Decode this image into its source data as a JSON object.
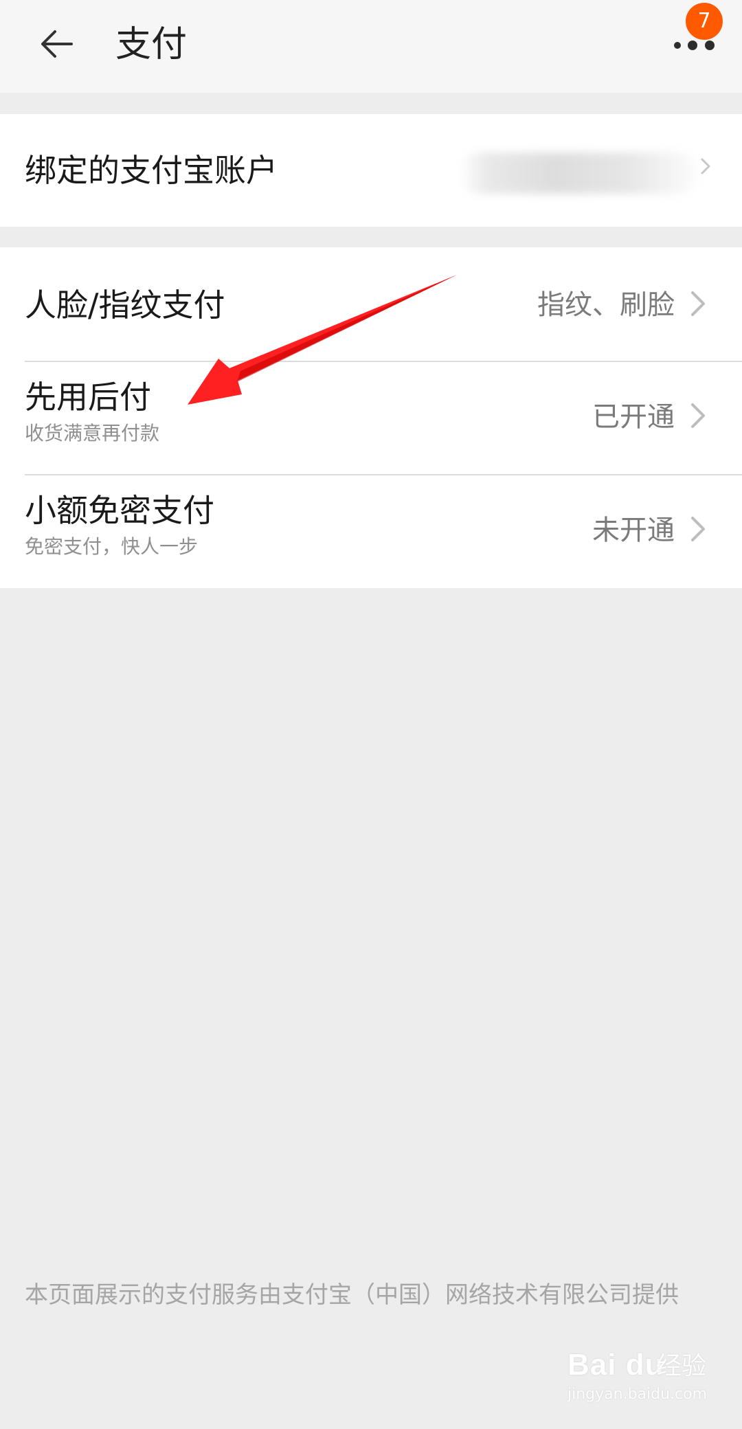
{
  "header": {
    "title": "支付",
    "back_icon": "arrow-left-icon",
    "more_icon": "more-dots-icon",
    "badge_count": "7",
    "badge_color": "#ff5a00"
  },
  "alipay_section": {
    "label": "绑定的支付宝账户",
    "value_obscured": true
  },
  "payment_settings": [
    {
      "title": "人脸/指纹支付",
      "subtitle": "",
      "value": "指纹、刷脸"
    },
    {
      "title": "先用后付",
      "subtitle": "收货满意再付款",
      "value": "已开通"
    },
    {
      "title": "小额免密支付",
      "subtitle": "免密支付，快人一步",
      "value": "未开通"
    }
  ],
  "footer": {
    "note": "本页面展示的支付服务由支付宝（中国）网络技术有限公司提供"
  },
  "annotation": {
    "type": "red-arrow",
    "color": "#ff1a1a",
    "points_to": "先用后付"
  },
  "watermark": {
    "logo": "Bai du",
    "cn": "经验",
    "url": "jingyan.baidu.com"
  }
}
